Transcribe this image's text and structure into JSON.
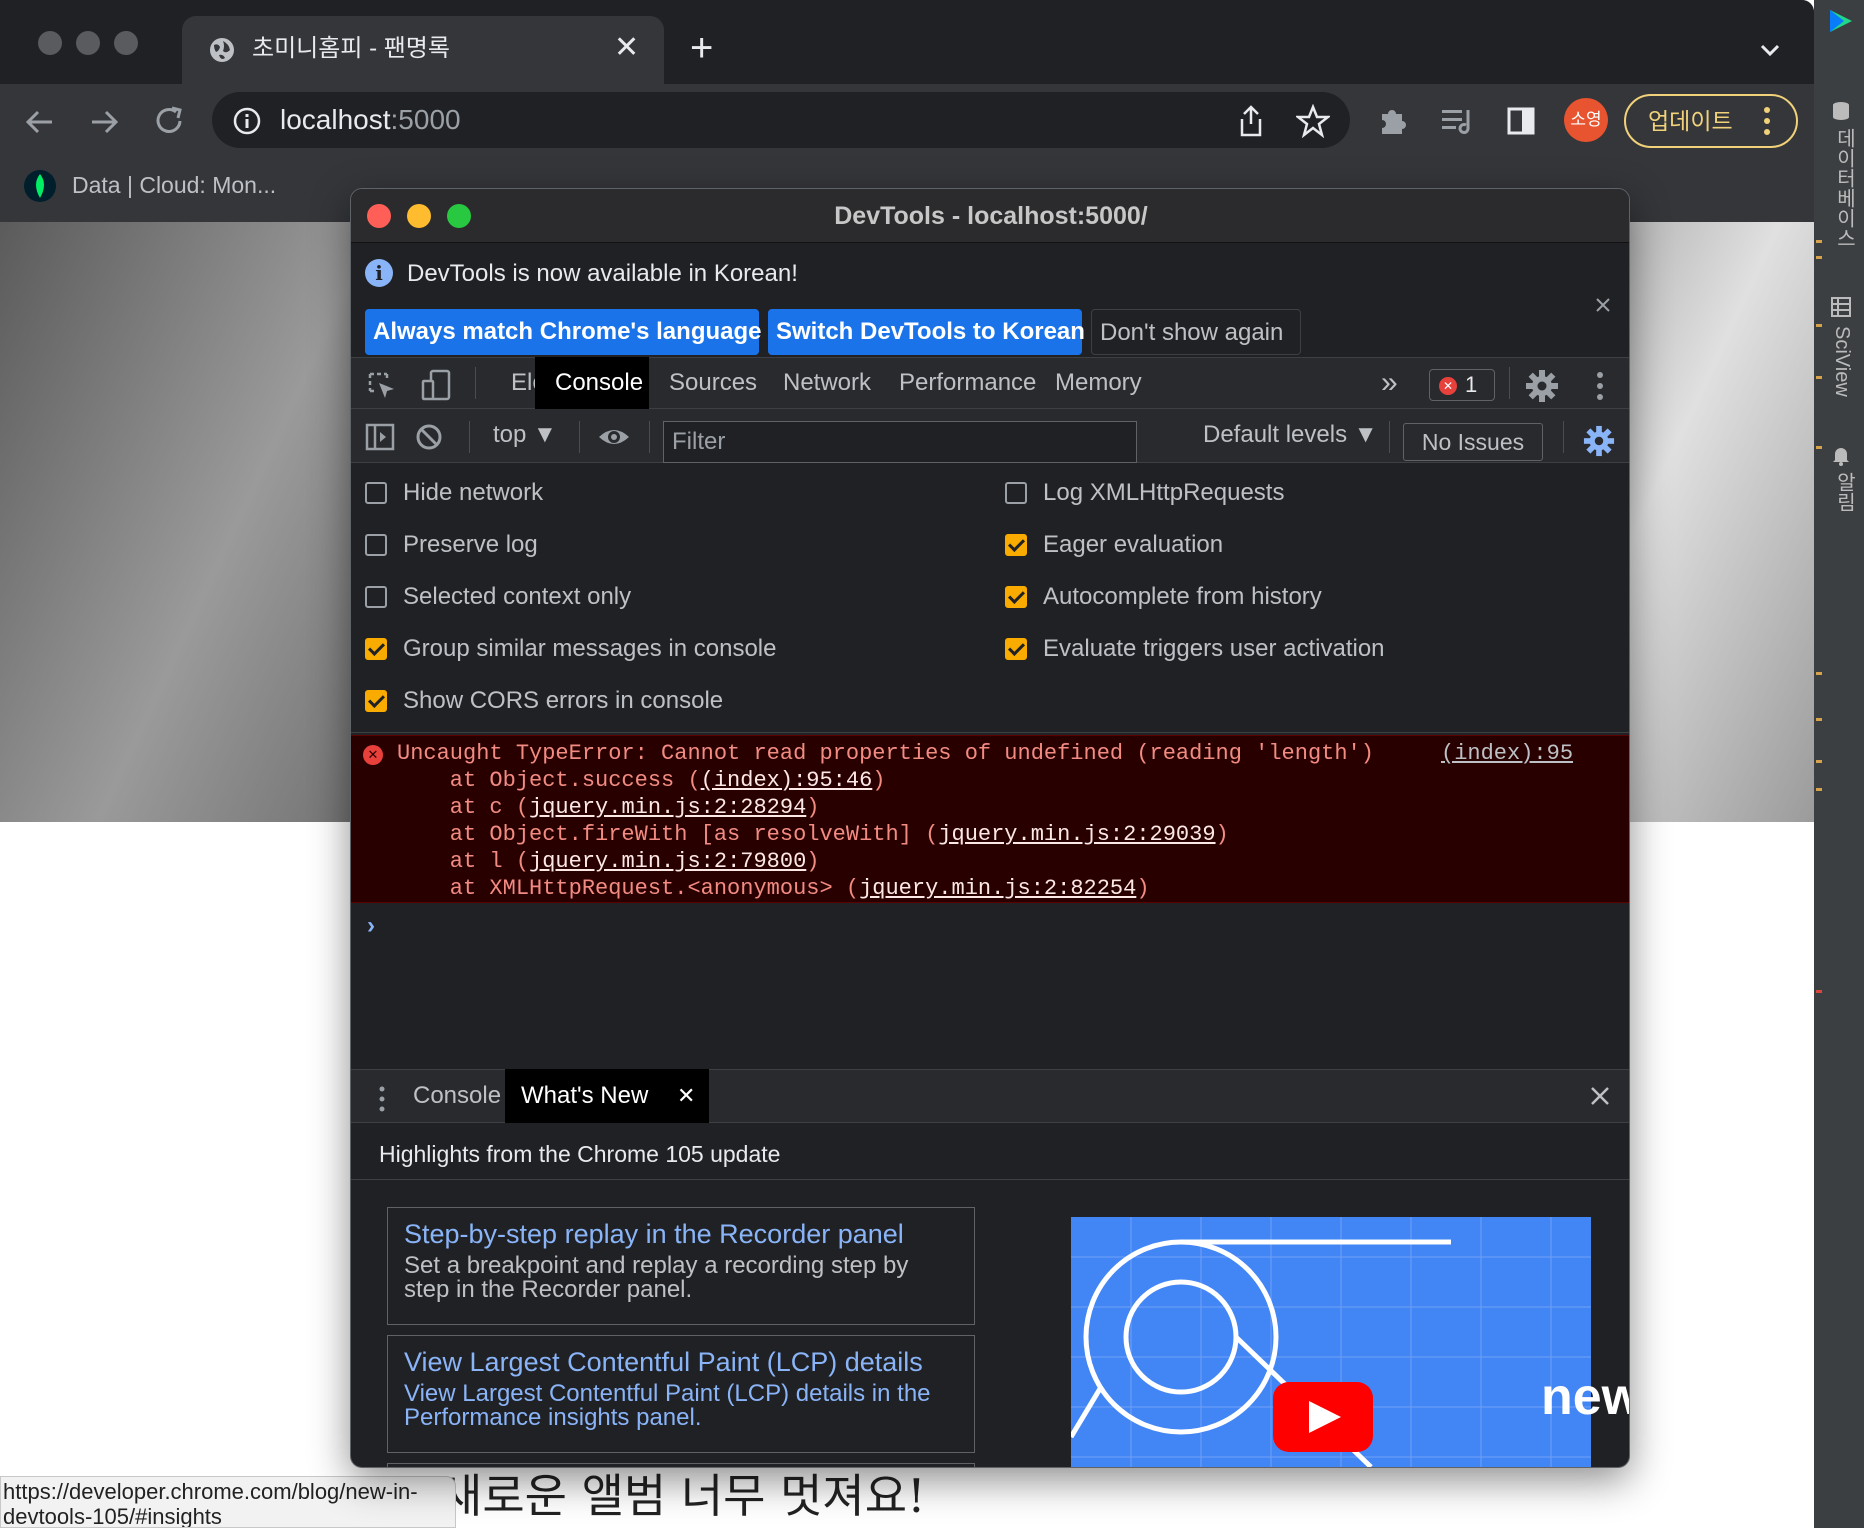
{
  "browser": {
    "tab_title": "초미니홈피 - 팬명록",
    "tab_close": "✕",
    "new_tab": "+",
    "url_host": "localhost",
    "url_port": ":5000",
    "profile_initials": "소영",
    "update_label": "업데이트",
    "bookmark_label": "Data | Cloud: Mon..."
  },
  "page": {
    "status_url": "https://developer.chrome.com/blog/new-in-devtools-105/#insights",
    "korean_text": "새로운 앨범 너무 멋져요!"
  },
  "ide": {
    "labels": [
      "데이터베이스",
      "SciView",
      "알림"
    ]
  },
  "devtools": {
    "window_title": "DevTools - localhost:5000/",
    "infobar": {
      "message": "DevTools is now available in Korean!",
      "btn_match": "Always match Chrome's language",
      "btn_korean": "Switch DevTools to Korean",
      "btn_dont": "Don't show again"
    },
    "tabs": [
      "Elements",
      "Console",
      "Sources",
      "Network",
      "Performance",
      "Memory"
    ],
    "active_tab": "Console",
    "more_tabs": "»",
    "error_count": "1",
    "toolbar": {
      "context": "top ▼",
      "filter_placeholder": "Filter",
      "levels": "Default levels ▼",
      "issues": "No Issues"
    },
    "settings": {
      "left": [
        {
          "label": "Hide network",
          "checked": false
        },
        {
          "label": "Preserve log",
          "checked": false
        },
        {
          "label": "Selected context only",
          "checked": false
        },
        {
          "label": "Group similar messages in console",
          "checked": true
        },
        {
          "label": "Show CORS errors in console",
          "checked": true
        }
      ],
      "right": [
        {
          "label": "Log XMLHttpRequests",
          "checked": false
        },
        {
          "label": "Eager evaluation",
          "checked": true
        },
        {
          "label": "Autocomplete from history",
          "checked": true
        },
        {
          "label": "Evaluate triggers user activation",
          "checked": true
        }
      ]
    },
    "error": {
      "message": "Uncaught TypeError: Cannot read properties of undefined (reading 'length')",
      "source": "(index):95",
      "stack": [
        {
          "pre": "    at Object.success (",
          "link": "(index):95:46",
          "post": ")"
        },
        {
          "pre": "    at c (",
          "link": "jquery.min.js:2:28294",
          "post": ")"
        },
        {
          "pre": "    at Object.fireWith [as resolveWith] (",
          "link": "jquery.min.js:2:29039",
          "post": ")"
        },
        {
          "pre": "    at l (",
          "link": "jquery.min.js:2:79800",
          "post": ")"
        },
        {
          "pre": "    at XMLHttpRequest.<anonymous> (",
          "link": "jquery.min.js:2:82254",
          "post": ")"
        }
      ]
    },
    "prompt": "›",
    "drawer": {
      "tabs": [
        "Console",
        "What's New"
      ],
      "active": "What's New",
      "tab_close": "✕",
      "highlights": "Highlights from the Chrome 105 update",
      "cards": [
        {
          "title": "Step-by-step replay in the Recorder panel",
          "desc": "Set a breakpoint and replay a recording step by step in the Recorder panel.",
          "desc_color": "#bdc1c6"
        },
        {
          "title": "View Largest Contentful Paint (LCP) details",
          "desc": "View Largest Contentful Paint (LCP) details in the Performance insights panel.",
          "desc_color": "#8ab4f8"
        }
      ],
      "video_word": "new"
    }
  },
  "colors": {
    "accent_blue": "#1a73e8",
    "checkbox_on": "#f9ab00",
    "error_bg": "#290000",
    "error_text": "#f28b82",
    "link_blue": "#8ab4f8",
    "update_yellow": "#f1d27a"
  }
}
